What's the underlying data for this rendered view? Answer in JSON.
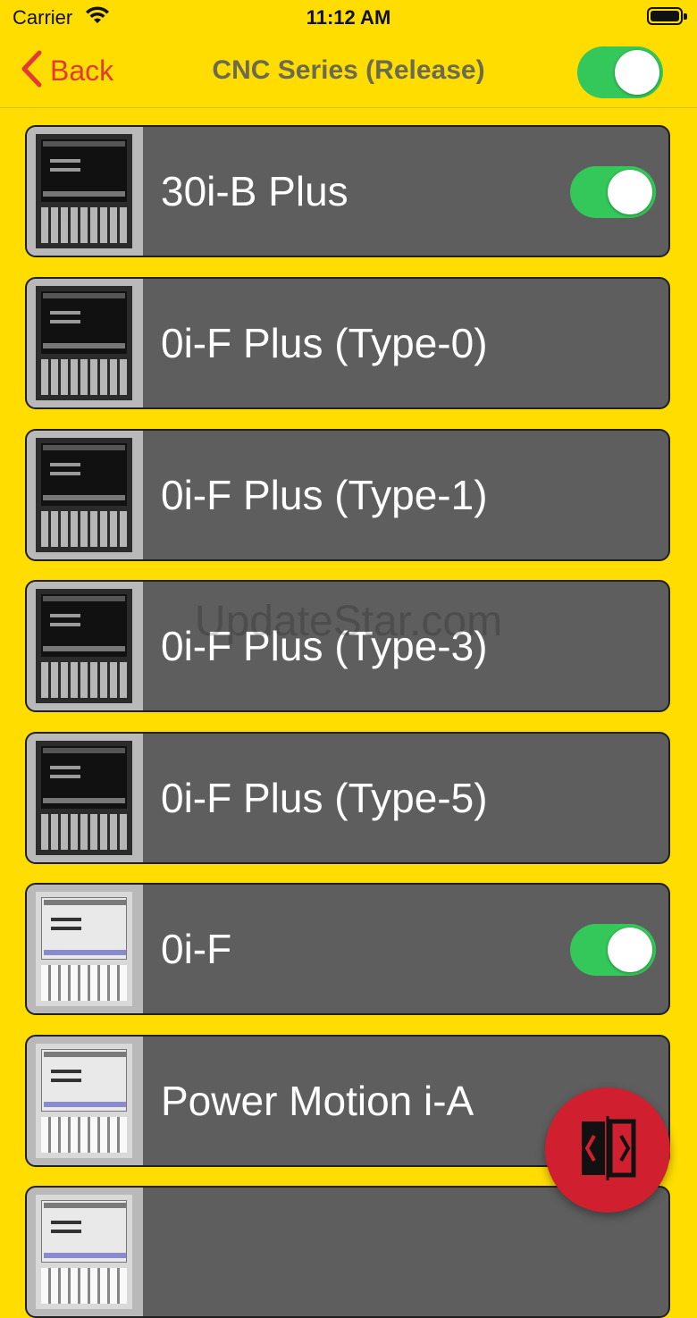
{
  "status_bar": {
    "carrier": "Carrier",
    "time": "11:12 AM"
  },
  "nav": {
    "back_label": "Back",
    "title": "CNC Series (Release)",
    "toggle_on": true
  },
  "list": {
    "items": [
      {
        "label": "30i-B Plus",
        "toggle": true,
        "thumb": "dark"
      },
      {
        "label": "0i-F Plus (Type-0)",
        "toggle": false,
        "thumb": "dark"
      },
      {
        "label": "0i-F Plus (Type-1)",
        "toggle": false,
        "thumb": "dark"
      },
      {
        "label": "0i-F Plus (Type-3)",
        "toggle": false,
        "thumb": "dark"
      },
      {
        "label": "0i-F Plus (Type-5)",
        "toggle": false,
        "thumb": "dark"
      },
      {
        "label": "0i-F",
        "toggle": true,
        "thumb": "light"
      },
      {
        "label": "Power Motion i-A",
        "toggle": false,
        "thumb": "light"
      },
      {
        "label": "",
        "toggle": false,
        "thumb": "light"
      }
    ]
  },
  "watermark": "UpdateStar.com",
  "colors": {
    "background": "#FFDD00",
    "accent_back": "#E53935",
    "toggle_on": "#34C759",
    "row_bg": "#5e5e5e",
    "fab": "#D0202F"
  },
  "icons": {
    "fab": "switch-panel-icon",
    "back": "chevron-left-icon"
  }
}
